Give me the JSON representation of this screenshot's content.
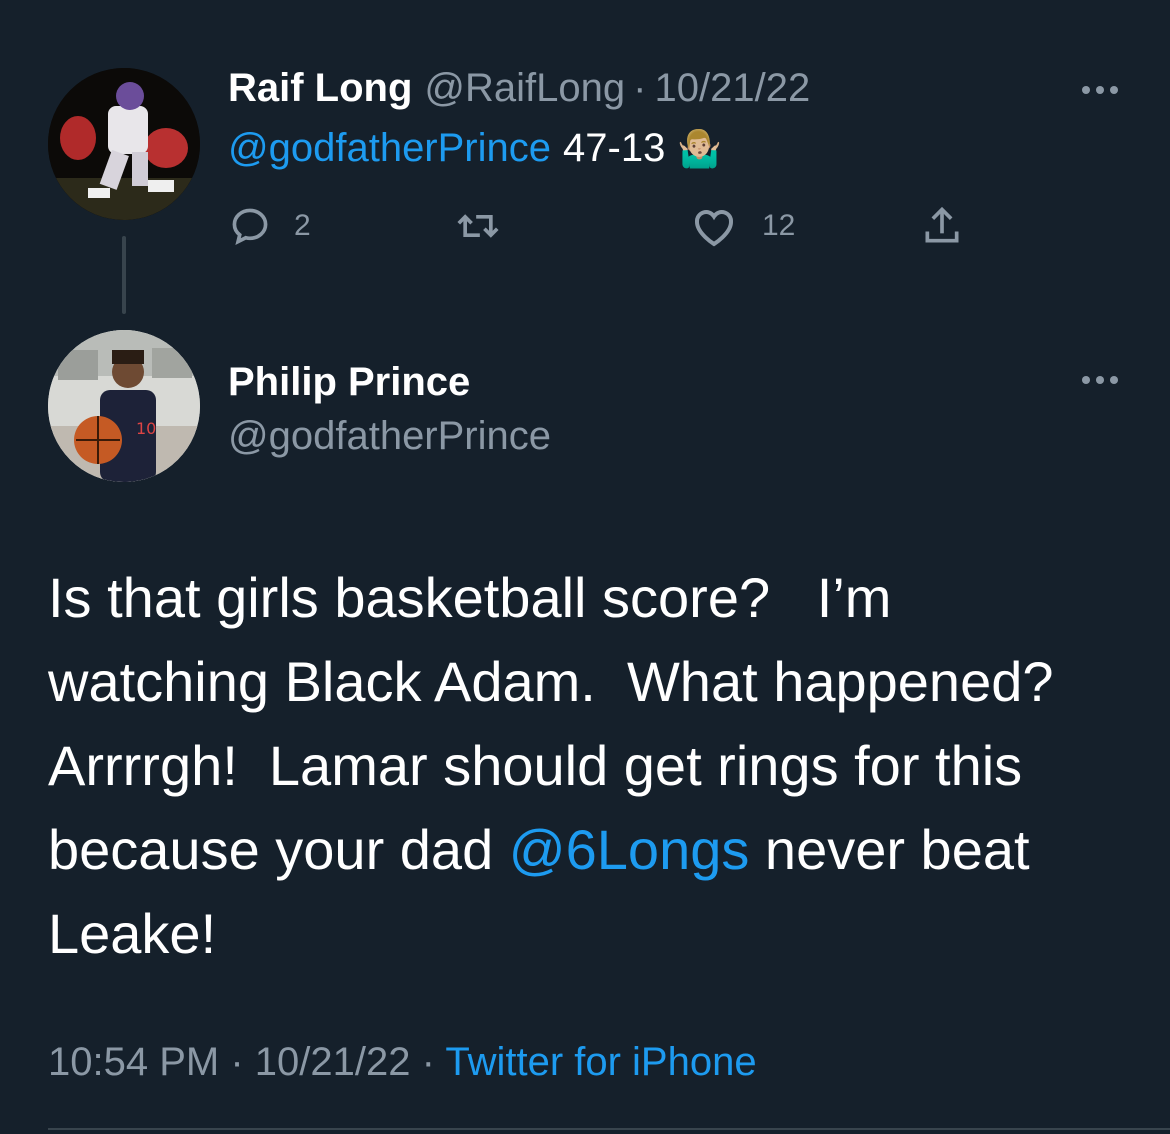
{
  "reply_tweet": {
    "display_name": "Raif Long",
    "handle": "@RaifLong",
    "separator": "·",
    "date": "10/21/22",
    "mention": "@godfatherPrince",
    "text": "47-13",
    "emoji": "🤷🏼‍♂️",
    "actions": {
      "reply_count": "2",
      "retweet_count": "",
      "like_count": "12"
    }
  },
  "main_tweet": {
    "display_name": "Philip Prince",
    "handle": "@godfatherPrince",
    "body_part1": "Is that girls basketball score?   I’m watching Black Adam.  What happened?  Arrrrgh!  Lamar should get rings for this because your dad ",
    "body_mention": "@6Longs",
    "body_part2": " never beat Leake!",
    "time": "10:54 PM",
    "sep1": "·",
    "date": "10/21/22",
    "sep2": "·",
    "source": "Twitter for iPhone"
  },
  "colors": {
    "background": "#15202b",
    "link": "#1d9bf0",
    "muted": "#8b98a5",
    "text": "#ffffff"
  },
  "icons": [
    "reply-icon",
    "retweet-icon",
    "like-icon",
    "share-icon",
    "more-icon"
  ]
}
